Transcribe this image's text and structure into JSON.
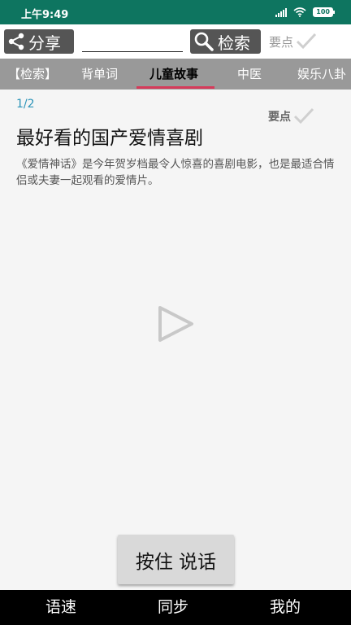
{
  "status_bar": {
    "time": "上午9:49",
    "battery": "100"
  },
  "toolbar": {
    "share_label": "分享",
    "search_value": "",
    "search_label": "检索",
    "keypoint_label": "要点"
  },
  "tabs": [
    {
      "label": "【检索】",
      "active": false
    },
    {
      "label": "背单词",
      "active": false
    },
    {
      "label": "儿童故事",
      "active": true
    },
    {
      "label": "中医",
      "active": false
    },
    {
      "label": "娱乐八卦",
      "active": false
    }
  ],
  "content": {
    "page_indicator": "1/2",
    "keypoint_label": "要点",
    "title": "最好看的国产爱情喜剧",
    "body": "《爱情神话》是今年贺岁档最令人惊喜的喜剧电影，也是最适合情侣或夫妻一起观看的爱情片。"
  },
  "talk_button_label": "按住 说话",
  "bottom_nav": [
    {
      "label": "语速"
    },
    {
      "label": "同步"
    },
    {
      "label": "我的"
    }
  ],
  "colors": {
    "status_bar": "#0e7560",
    "tab_bar": "#999999",
    "tab_underline": "#d63a5a",
    "page_indicator": "#2a93b8",
    "bottom_nav": "#000000"
  },
  "icons": [
    "share-icon",
    "search-icon",
    "check-icon",
    "play-icon",
    "signal-icon",
    "wifi-icon",
    "battery-icon"
  ]
}
